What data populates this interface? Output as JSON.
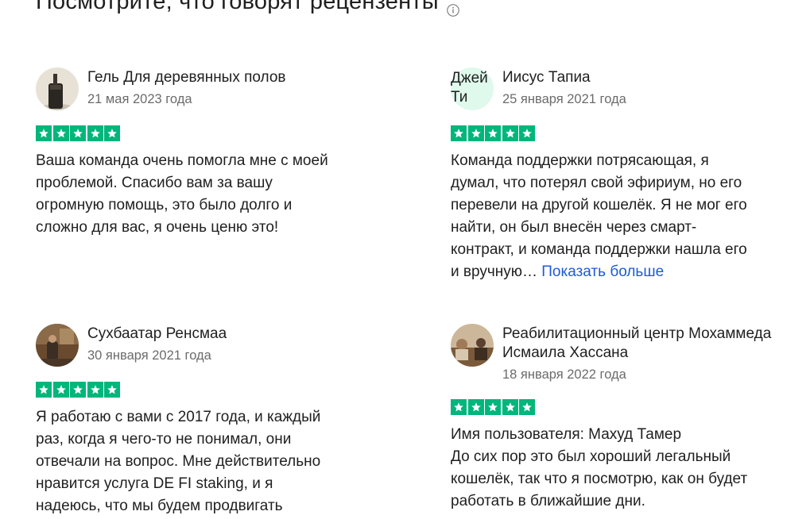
{
  "section": {
    "title": "Посмотрите, что говорят рецензенты",
    "info_icon": "info-circle-icon"
  },
  "colors": {
    "star_green": "#00b67a",
    "link_blue": "#1d5bd6",
    "date_gray": "#6b6b6b",
    "initials_bg": "#dff9ec"
  },
  "reviews": [
    {
      "author": "Гель Для деревянных полов",
      "date": "21 мая 2023 года",
      "rating": 5,
      "text": "Ваша команда очень помогла мне с моей\nпроблемой. Спасибо вам за вашу\nогромную помощь, это было долго и\nсложно для вас, я очень ценю это!"
    },
    {
      "author": "Иисус Тапиа",
      "initials": "Джей Ти",
      "date": "25 января 2021 года",
      "rating": 5,
      "text": "Команда поддержки потрясающая, я\nдумал, что потерял свой эфириум, но его\nперевели на другой кошелёк. Я не мог его\nнайти, он был внесён через смарт-\nконтракт, и команда поддержки нашла его\nи вручную… ",
      "show_more": "Показать больше"
    },
    {
      "author": "Сухбаатар Ренсмаа",
      "date": "30 января 2021 года",
      "rating": 5,
      "text": "Я работаю с вами с 2017 года, и каждый\nраз, когда я чего-то не понимал, они\nотвечали на вопрос. Мне действительно\nнравится услуга DE FI staking, и я\nнадеюсь, что мы будем продвигать"
    },
    {
      "author": "Реабилитационный центр Мохаммеда Исмаила Хассана",
      "date": "18 января 2022 года",
      "rating": 5,
      "text": "Имя пользователя: Махуд Тамер\nДо сих пор это был хороший легальный\nкошелёк, так что я посмотрю, как он будет\nработать в ближайшие дни."
    }
  ]
}
